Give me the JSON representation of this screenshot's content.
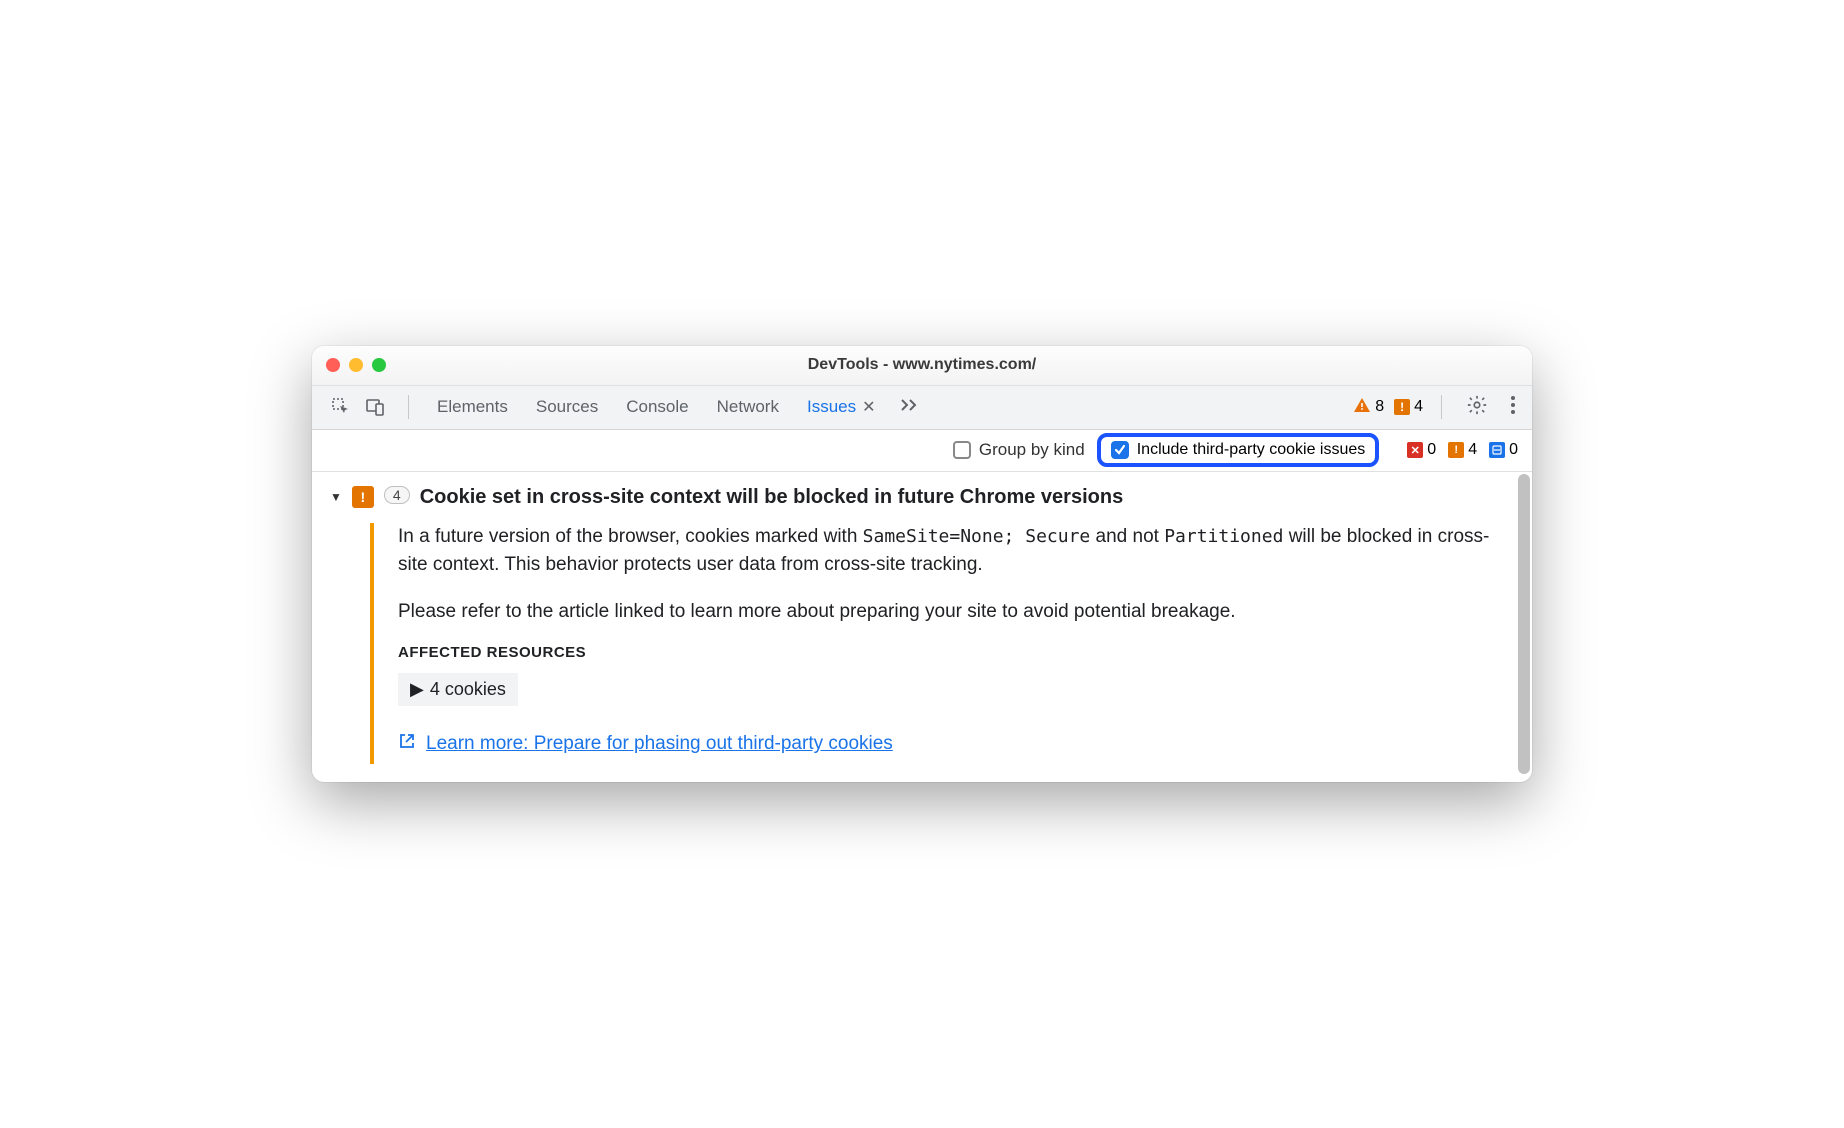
{
  "window": {
    "title": "DevTools - www.nytimes.com/"
  },
  "toolbar": {
    "tabs": [
      {
        "label": "Elements"
      },
      {
        "label": "Sources"
      },
      {
        "label": "Console"
      },
      {
        "label": "Network"
      },
      {
        "label": "Issues",
        "active": true
      }
    ],
    "warnings_count": "8",
    "errors_count": "4"
  },
  "filters": {
    "group_by_kind_label": "Group by kind",
    "group_by_kind_checked": false,
    "third_party_label": "Include third-party cookie issues",
    "third_party_checked": true,
    "counts": {
      "errors": "0",
      "warnings": "4",
      "info": "0"
    }
  },
  "issue": {
    "badge_count": "4",
    "title": "Cookie set in cross-site context will be blocked in future Chrome versions",
    "p1_pre": "In a future version of the browser, cookies marked with ",
    "code1": "SameSite=None; Secure",
    "p1_mid": " and not ",
    "code2": "Partitioned",
    "p1_post": " will be blocked in cross-site context. This behavior protects user data from cross-site tracking.",
    "p2": "Please refer to the article linked to learn more about preparing your site to avoid potential breakage.",
    "affected_header": "AFFECTED RESOURCES",
    "affected_item": "4 cookies",
    "learn_more": "Learn more: Prepare for phasing out third-party cookies"
  }
}
